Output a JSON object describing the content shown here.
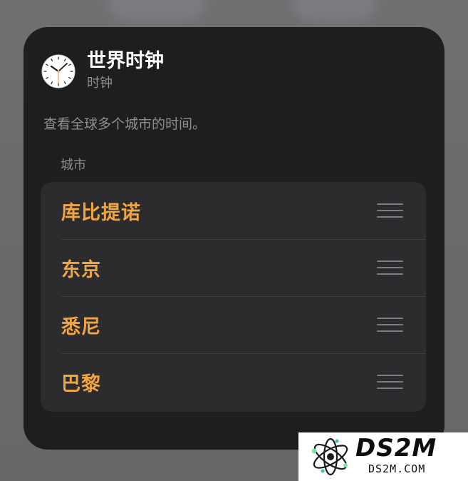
{
  "widget": {
    "title": "世界时钟",
    "subtitle": "时钟",
    "icon": "clock-icon",
    "description": "查看全球多个城市的时间。",
    "section_header": "城市",
    "cities": [
      {
        "label": "库比提诺"
      },
      {
        "label": "东京"
      },
      {
        "label": "悉尼"
      },
      {
        "label": "巴黎"
      }
    ]
  },
  "watermark": {
    "brand": "DS2M",
    "url": "DS2M.COM"
  },
  "colors": {
    "card_background": "#1e1e1f",
    "list_background": "#2c2c2e",
    "accent_orange": "#f0a544",
    "secondary_text": "#8e8e93",
    "backdrop": "#6c6c6e"
  }
}
